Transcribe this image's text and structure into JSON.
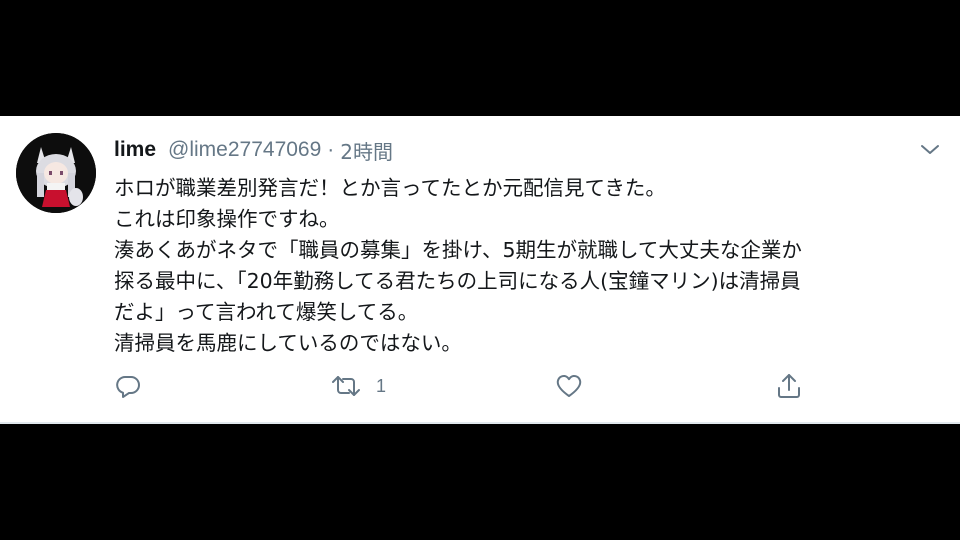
{
  "tweet": {
    "display_name": "lime",
    "handle": "@lime27747069",
    "separator": "·",
    "time": "2時間",
    "lines": [
      "ホロが職業差別発言だ！とか言ってたとか元配信見てきた。",
      "これは印象操作ですね。",
      "湊あくあがネタで「職員の募集」を掛け、5期生が就職して大丈夫な企業か",
      "探る最中に、「20年勤務してる君たちの上司になる人(宝鐘マリン)は清掃員",
      "だよ」って言われて爆笑してる。",
      "清掃員を馬鹿にしているのではない。"
    ]
  },
  "actions": {
    "reply_icon": "reply-icon",
    "retweet_icon": "retweet-icon",
    "retweet_count": "1",
    "like_icon": "heart-icon",
    "share_icon": "share-icon"
  },
  "colors": {
    "text": "#14171a",
    "secondary": "#657786",
    "background": "#ffffff",
    "letterbox": "#000000"
  }
}
